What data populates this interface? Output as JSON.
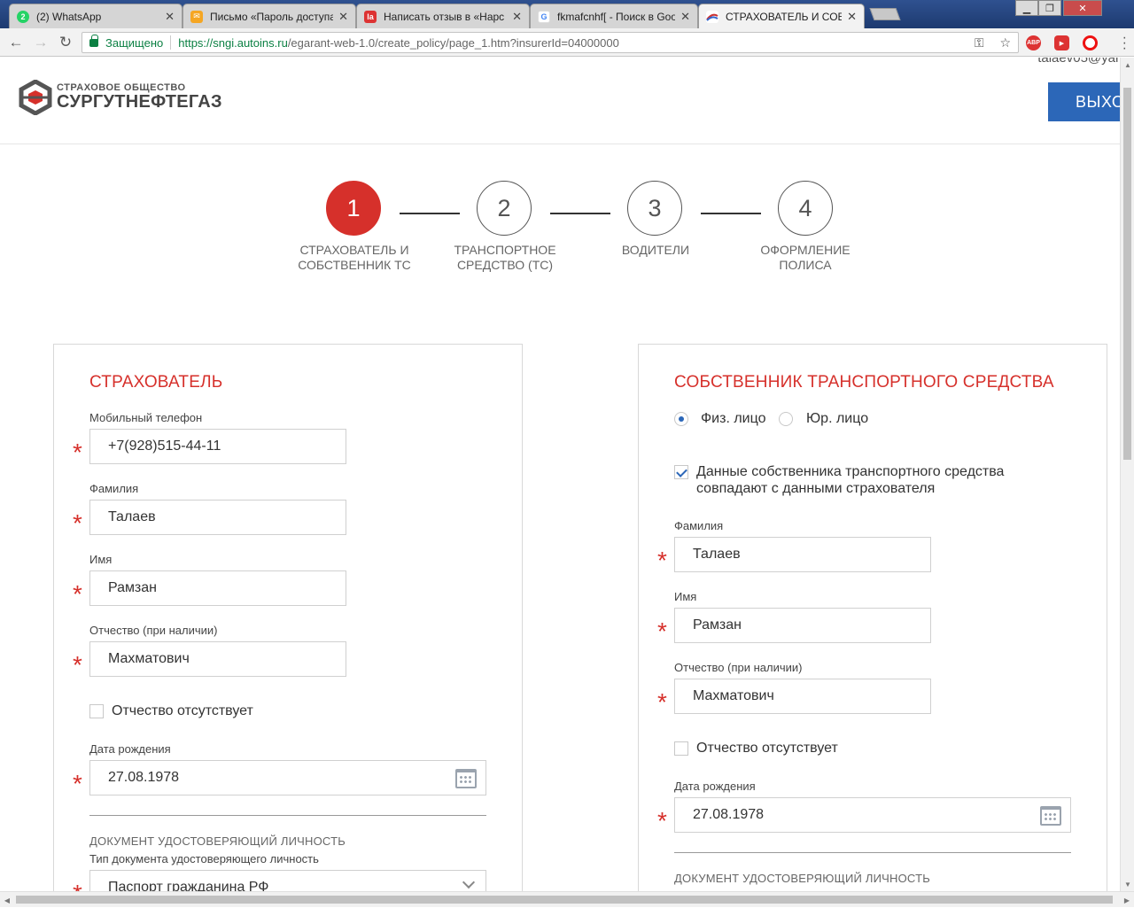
{
  "browser": {
    "tabs": [
      {
        "label": "(2) WhatsApp",
        "icon": "whatsapp-icon",
        "color": "#25d366",
        "badge": "2"
      },
      {
        "label": "Письмо «Пароль доступа",
        "icon": "mail-icon",
        "color": "#f5a623",
        "badge": ""
      },
      {
        "label": "Написать отзыв в «Нарс",
        "icon": "irecommend-icon",
        "color": "#d33",
        "badge": "la"
      },
      {
        "label": "fkmafcnhf[ - Поиск в Goo",
        "icon": "google-icon",
        "color": "#fff",
        "badge": "G"
      },
      {
        "label": "СТРАХОВАТЕЛЬ И СОБС",
        "icon": "site-icon",
        "color": "#fff",
        "badge": ""
      }
    ],
    "tab_close": "✕",
    "secure_label": "Защищено",
    "url_host": "https://sngi.autoins.ru",
    "url_path": "/egarant-web-1.0/create_policy/page_1.htm?insurerId=04000000"
  },
  "header": {
    "logo_line1": "СТРАХОВОЕ ОБЩЕСТВО",
    "logo_line2": "СУРГУТНЕФТЕГАЗ",
    "user_email": "talaev05@yar",
    "exit_label": "ВЫХО"
  },
  "steps": [
    {
      "number": "1",
      "label": "СТРАХОВАТЕЛЬ И СОБСТВЕННИК ТС",
      "active": true
    },
    {
      "number": "2",
      "label": "ТРАНСПОРТНОЕ СРЕДСТВО (ТС)",
      "active": false
    },
    {
      "number": "3",
      "label": "ВОДИТЕЛИ",
      "active": false
    },
    {
      "number": "4",
      "label": "ОФОРМЛЕНИЕ ПОЛИСА",
      "active": false
    }
  ],
  "insurer": {
    "title": "СТРАХОВАТЕЛЬ",
    "phone_label": "Мобильный телефон",
    "phone_value": "+7(928)515-44-11",
    "lastname_label": "Фамилия",
    "lastname_value": "Талаев",
    "firstname_label": "Имя",
    "firstname_value": "Рамзан",
    "patronymic_label": "Отчество (при наличии)",
    "patronymic_value": "Махматович",
    "no_patronymic_label": "Отчество отсутствует",
    "birthdate_label": "Дата рождения",
    "birthdate_value": "27.08.1978",
    "doc_section": "ДОКУМЕНТ УДОСТОВЕРЯЮЩИЙ ЛИЧНОСТЬ",
    "doc_type_label": "Тип документа удостоверяющего личность",
    "doc_type_value": "Паспорт гражданина РФ"
  },
  "owner": {
    "title": "СОБСТВЕННИК ТРАНСПОРТНОГО СРЕДСТВА",
    "radio_individual": "Физ. лицо",
    "radio_legal": "Юр. лицо",
    "same_as_insurer_line1": "Данные собственника транспортного средства",
    "same_as_insurer_line2": "совпадают с данными страхователя",
    "lastname_label": "Фамилия",
    "lastname_value": "Талаев",
    "firstname_label": "Имя",
    "firstname_value": "Рамзан",
    "patronymic_label": "Отчество (при наличии)",
    "patronymic_value": "Махматович",
    "no_patronymic_label": "Отчество отсутствует",
    "birthdate_label": "Дата рождения",
    "birthdate_value": "27.08.1978",
    "doc_section": "ДОКУМЕНТ УДОСТОВЕРЯЮЩИЙ ЛИЧНОСТЬ"
  },
  "required_mark": "*",
  "colors": {
    "accent": "#d6302b",
    "primary": "#2c67b8"
  }
}
